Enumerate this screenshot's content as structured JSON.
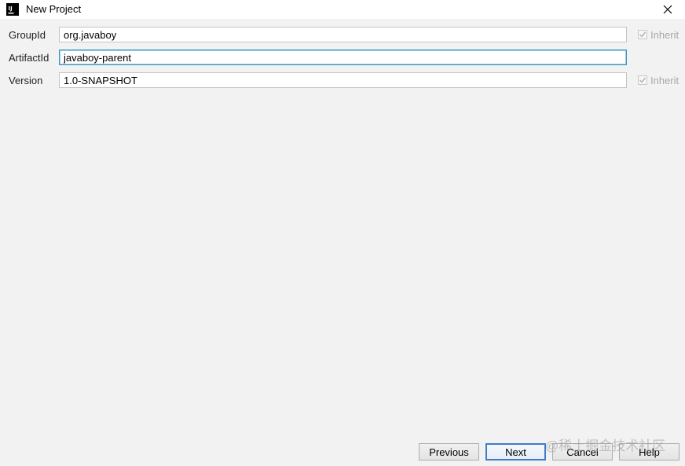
{
  "window": {
    "title": "New Project",
    "app_icon_text": "IJ"
  },
  "form": {
    "group_id": {
      "label": "GroupId",
      "value": "org.javaboy",
      "inherit_label": "Inherit",
      "inherit_checked": true
    },
    "artifact_id": {
      "label": "ArtifactId",
      "value": "javaboy-parent"
    },
    "version": {
      "label": "Version",
      "value": "1.0-SNAPSHOT",
      "inherit_label": "Inherit",
      "inherit_checked": true
    }
  },
  "buttons": {
    "previous": "Previous",
    "next": "Next",
    "cancel": "Cancel",
    "help": "Help"
  },
  "watermark": "@稀土掘金技术社区",
  "colors": {
    "focus_border": "#3d94c6",
    "default_button_border": "#3d7bc6",
    "disabled_text": "#a8a8a8"
  }
}
